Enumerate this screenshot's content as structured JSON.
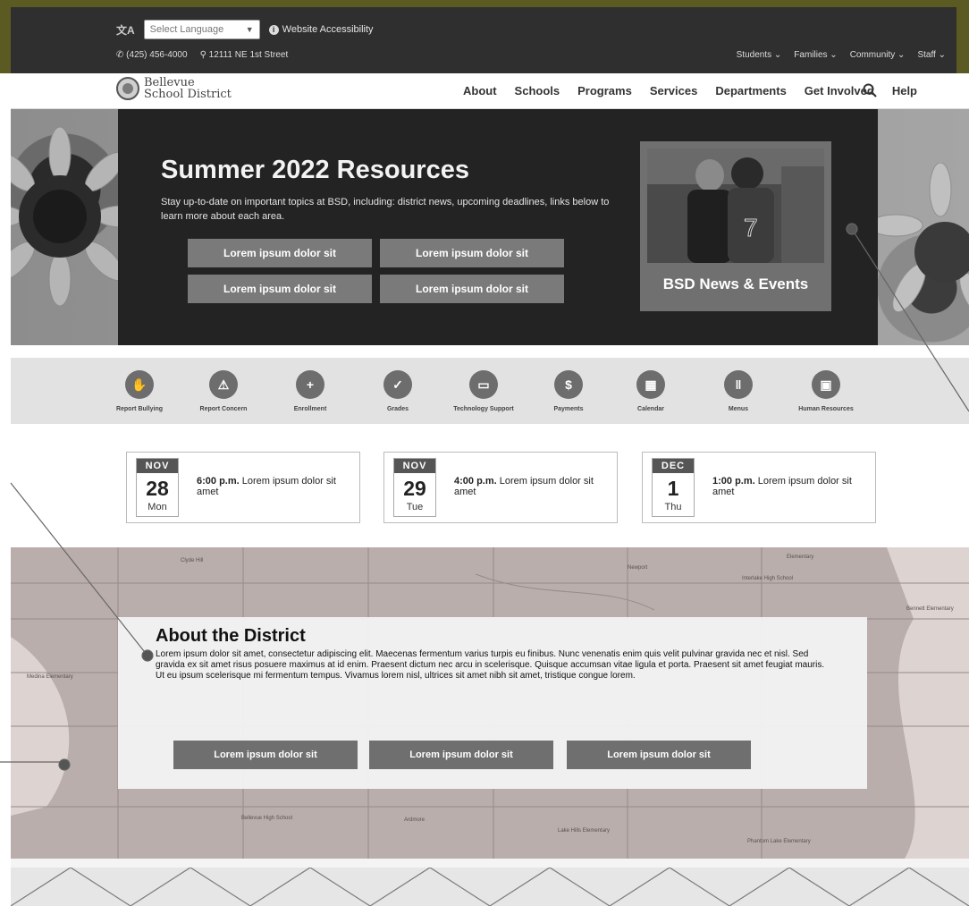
{
  "utility": {
    "lang_icon": "文A",
    "lang_select": "Select Language",
    "accessibility": "Website Accessibility",
    "phone": "(425) 456-4000",
    "address": "12111 NE 1st Street",
    "audience_links": [
      "Students",
      "Families",
      "Community",
      "Staff"
    ]
  },
  "logo": {
    "line1": "Bellevue",
    "line2": "School District"
  },
  "nav": {
    "items": [
      "About",
      "Schools",
      "Programs",
      "Services",
      "Departments",
      "Get Involved",
      "Help"
    ]
  },
  "hero": {
    "title": "Summer 2022 Resources",
    "description": "Stay up-to-date on important topics at BSD, including: district news, upcoming deadlines, links below to learn more about each area.",
    "buttons": [
      "Lorem ipsum dolor sit",
      "Lorem ipsum dolor sit",
      "Lorem ipsum dolor sit",
      "Lorem ipsum dolor sit"
    ],
    "news_card": "BSD News & Events",
    "jersey_number": "7"
  },
  "quick_links": [
    {
      "label": "Report Bullying",
      "icon": "hand-icon",
      "glyph": "✋"
    },
    {
      "label": "Report Concern",
      "icon": "warning-icon",
      "glyph": "⚠"
    },
    {
      "label": "Enrollment",
      "icon": "add-user-icon",
      "glyph": "+"
    },
    {
      "label": "Grades",
      "icon": "check-icon",
      "glyph": "✓"
    },
    {
      "label": "Technology Support",
      "icon": "laptop-icon",
      "glyph": "▭"
    },
    {
      "label": "Payments",
      "icon": "dollar-icon",
      "glyph": "$"
    },
    {
      "label": "Calendar",
      "icon": "calendar-icon",
      "glyph": "▦"
    },
    {
      "label": "Menus",
      "icon": "utensils-icon",
      "glyph": "ǁ"
    },
    {
      "label": "Human Resources",
      "icon": "id-card-icon",
      "glyph": "▣"
    }
  ],
  "events": [
    {
      "month": "NOV",
      "day": "28",
      "dow": "Mon",
      "time": "6:00 p.m.",
      "text": "Lorem ipsum dolor sit amet"
    },
    {
      "month": "NOV",
      "day": "29",
      "dow": "Tue",
      "time": "4:00 p.m.",
      "text": "Lorem ipsum dolor sit amet"
    },
    {
      "month": "DEC",
      "day": "1",
      "dow": "Thu",
      "time": "1:00 p.m.",
      "text": "Lorem ipsum dolor sit amet"
    }
  ],
  "about": {
    "title": "About the District",
    "text": "Lorem ipsum dolor sit amet, consectetur adipiscing elit. Maecenas fermentum varius turpis eu finibus. Nunc venenatis enim quis velit pulvinar gravida nec et nisl. Sed gravida ex sit amet risus posuere maximus at id enim. Praesent dictum nec arcu in scelerisque. Quisque accumsan vitae ligula et porta. Praesent sit amet feugiat mauris. Ut eu ipsum scelerisque mi fermentum tempus. Vivamus lorem nisl, ultrices sit amet nibh sit amet, tristique congue lorem.",
    "buttons": [
      "Lorem ipsum dolor sit",
      "Lorem ipsum dolor sit",
      "Lorem ipsum dolor sit"
    ]
  },
  "map_labels": [
    "Elementary",
    "Bennett Elementary",
    "Medina Elementary",
    "Lake Hills Elementary",
    "Phantom Lake Elementary",
    "Clyde Hill",
    "Newport",
    "Interlake High School",
    "Ardmore",
    "Bellevue High School"
  ],
  "colors": {
    "olive_frame": "#5b5a23",
    "utility_bar": "#2f2f2f",
    "hero_panel": "#232323",
    "button": "#7a7a7a",
    "quick_links_bg": "#e2e2e2",
    "map_tint": "#b9aeab"
  }
}
